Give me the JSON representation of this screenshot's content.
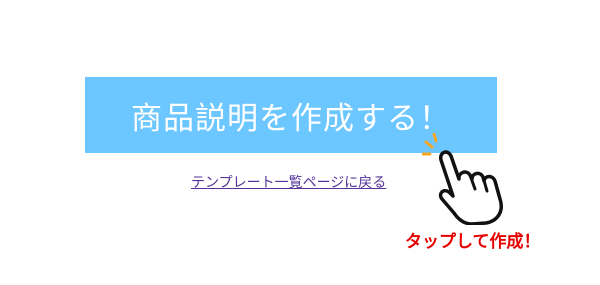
{
  "create_button": {
    "label": "商品説明を作成する！",
    "color": "#6cc6ff"
  },
  "template_link": {
    "label": "テンプレート一覧ページに戻る"
  },
  "hint": {
    "icon": "pointing-hand-icon",
    "caption": "タップして作成！",
    "caption_color": "#e60000",
    "tap_mark_color": "#f5a623"
  }
}
